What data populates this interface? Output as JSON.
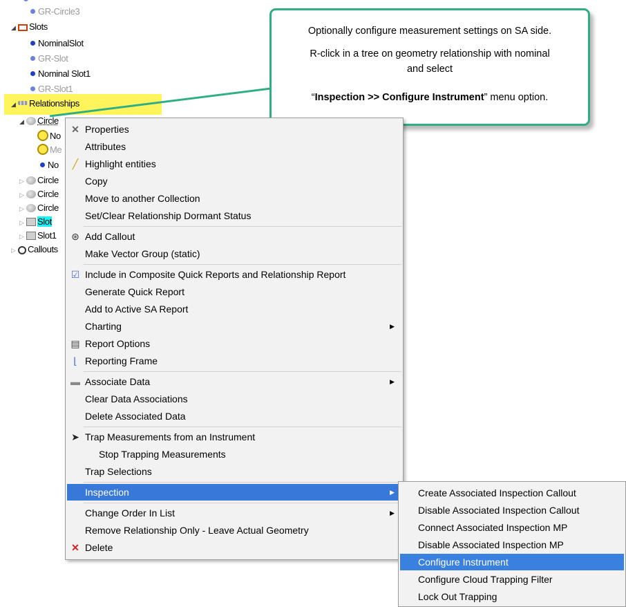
{
  "tree": {
    "items": [
      {
        "label": "GR-Circle3"
      },
      {
        "label": "Slots"
      },
      {
        "label": "NominalSlot"
      },
      {
        "label": "GR-Slot"
      },
      {
        "label": "Nominal Slot1"
      },
      {
        "label": "GR-Slot1"
      },
      {
        "label": "Relationships"
      },
      {
        "label": "Circle"
      },
      {
        "label": "No"
      },
      {
        "label": "Me"
      },
      {
        "label": "No"
      },
      {
        "label": "Circle"
      },
      {
        "label": "Circle"
      },
      {
        "label": "Circle"
      },
      {
        "label": "Slot"
      },
      {
        "label": "Slot1"
      },
      {
        "label": "Callouts"
      }
    ]
  },
  "callout": {
    "line1": "Optionally configure measurement settings on SA side.",
    "line2": "R-click in a tree on geometry relationship with nominal",
    "line3": "and select",
    "quote_open": "“",
    "bold": "Inspection >> Configure Instrument",
    "quote_tail": "” menu option."
  },
  "context_menu": {
    "items": [
      {
        "label": "Properties",
        "icon": "wrench-icon"
      },
      {
        "label": "Attributes"
      },
      {
        "label": "Highlight entities",
        "icon": "pencil-icon"
      },
      {
        "label": "Copy"
      },
      {
        "label": "Move to another Collection"
      },
      {
        "label": "Set/Clear Relationship Dormant Status"
      },
      {
        "label": "Add Callout",
        "icon": "callout-icon"
      },
      {
        "label": "Make Vector Group (static)"
      },
      {
        "label": "Include in Composite Quick Reports and Relationship Report",
        "icon": "report-check-icon"
      },
      {
        "label": "Generate Quick Report"
      },
      {
        "label": "Add to Active SA Report"
      },
      {
        "label": "Charting",
        "submenu": true
      },
      {
        "label": "Report Options",
        "icon": "report-options-icon"
      },
      {
        "label": "Reporting Frame",
        "icon": "frame-axes-icon"
      },
      {
        "label": "Associate Data",
        "icon": "link-icon",
        "submenu": true
      },
      {
        "label": "Clear Data Associations"
      },
      {
        "label": "Delete Associated Data"
      },
      {
        "label": "Trap Measurements from an Instrument",
        "icon": "trap-arrow-icon"
      },
      {
        "label": "Stop Trapping Measurements"
      },
      {
        "label": "Trap Selections"
      },
      {
        "label": "Inspection",
        "submenu": true,
        "selected": true
      },
      {
        "label": "Change Order In List",
        "submenu": true
      },
      {
        "label": "Remove Relationship Only - Leave Actual Geometry"
      },
      {
        "label": "Delete",
        "icon": "delete-x-icon"
      }
    ]
  },
  "submenu": {
    "items": [
      {
        "label": "Create Associated Inspection Callout"
      },
      {
        "label": "Disable Associated Inspection Callout"
      },
      {
        "label": "Connect Associated Inspection MP"
      },
      {
        "label": "Disable Associated Inspection MP"
      },
      {
        "label": "Configure Instrument",
        "selected": true
      },
      {
        "label": "Configure Cloud Trapping Filter"
      },
      {
        "label": "Lock Out Trapping"
      }
    ]
  },
  "colors": {
    "callout_border": "#2fae83",
    "selection": "#3778d8",
    "highlight_yellow": "#fff45c",
    "highlight_cyan": "#18f4f4",
    "delete_red": "#d42020"
  }
}
